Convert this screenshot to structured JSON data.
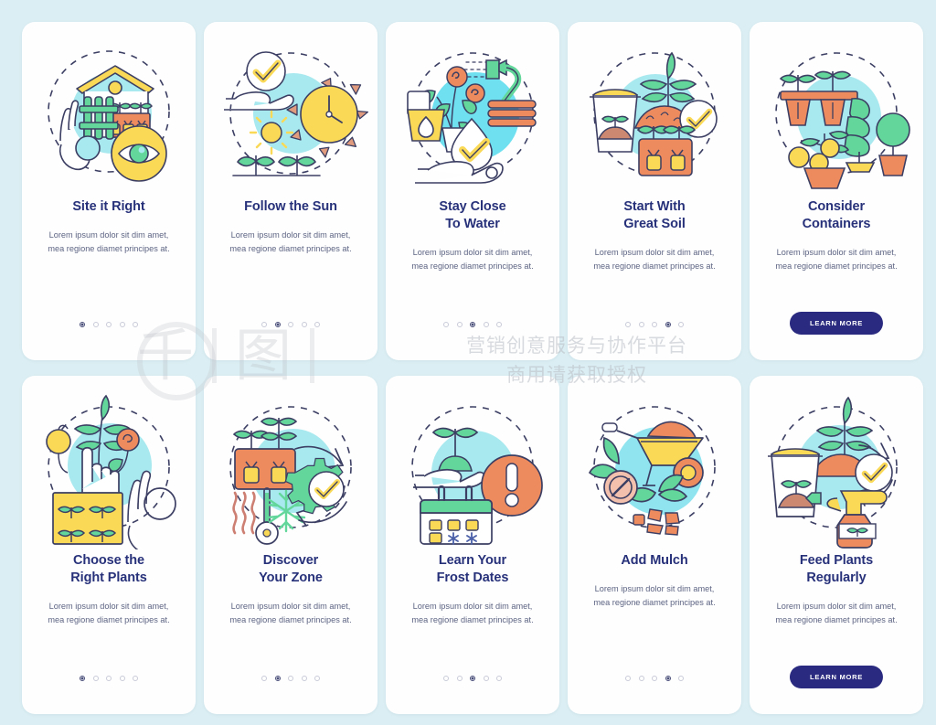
{
  "page": {
    "background_color": "#daeef3",
    "card_background": "#fefefe",
    "title_color": "#27317a",
    "body_color": "#5d6483",
    "accent_button_color": "#2a2a80",
    "dot_active_color": "#4a4f7a",
    "dot_inactive_color": "#c9cbd8"
  },
  "watermark": {
    "char_left": "千",
    "char_right": "图",
    "line1": "营销创意服务与协作平台",
    "line2": "商用请获取授权"
  },
  "cards": [
    {
      "id": "site-it-right",
      "icon": "garden-house-eye-icon",
      "title": "Site it Right",
      "body": "Lorem ipsum dolor sit dim amet, mea regione diamet principes at.",
      "dots": {
        "count": 5,
        "active_index": 0
      },
      "button": null
    },
    {
      "id": "follow-the-sun",
      "icon": "sun-clock-seedlings-icon",
      "title": "Follow the Sun",
      "body": "Lorem ipsum dolor sit dim amet, mea regione diamet principes at.",
      "dots": {
        "count": 5,
        "active_index": 1
      },
      "button": null
    },
    {
      "id": "stay-close-to-water",
      "icon": "watering-can-hose-droplet-icon",
      "title": "Stay Close\nTo Water",
      "title_line1": "Stay Close",
      "title_line2": "To Water",
      "body": "Lorem ipsum dolor sit dim amet, mea regione diamet principes at.",
      "dots": {
        "count": 5,
        "active_index": 2
      },
      "button": null
    },
    {
      "id": "start-with-great-soil",
      "icon": "soil-bag-seedling-check-icon",
      "title_line1": "Start With",
      "title_line2": "Great Soil",
      "body": "Lorem ipsum dolor sit dim amet, mea regione diamet principes at.",
      "dots": {
        "count": 5,
        "active_index": 3
      },
      "button": null
    },
    {
      "id": "consider-containers",
      "icon": "potted-plants-containers-icon",
      "title_line1": "Consider",
      "title_line2": "Containers",
      "body": "Lorem ipsum dolor sit dim amet, mea regione diamet principes at.",
      "dots": null,
      "button": {
        "label": "LEARN MORE"
      }
    },
    {
      "id": "choose-the-right-plants",
      "icon": "hand-pointing-seedling-tray-icon",
      "title_line1": "Choose the",
      "title_line2": "Right Plants",
      "body": "Lorem ipsum dolor sit dim amet, mea regione diamet principes at.",
      "dots": {
        "count": 5,
        "active_index": 0
      },
      "button": null
    },
    {
      "id": "discover-your-zone",
      "icon": "thermometer-gear-zone-icon",
      "title_line1": "Discover",
      "title_line2": "Your Zone",
      "body": "Lorem ipsum dolor sit dim amet, mea regione diamet principes at.",
      "dots": {
        "count": 5,
        "active_index": 1
      },
      "button": null
    },
    {
      "id": "learn-your-frost-dates",
      "icon": "calendar-frost-alert-icon",
      "title_line1": "Learn Your",
      "title_line2": "Frost Dates",
      "body": "Lorem ipsum dolor sit dim amet, mea regione diamet principes at.",
      "dots": {
        "count": 5,
        "active_index": 2
      },
      "button": null
    },
    {
      "id": "add-mulch",
      "icon": "wheelbarrow-mulch-icon",
      "title_line1": "Add Mulch",
      "title_line2": "",
      "body": "Lorem ipsum dolor sit dim amet, mea regione diamet principes at.",
      "dots": {
        "count": 5,
        "active_index": 3
      },
      "button": null
    },
    {
      "id": "feed-plants-regularly",
      "icon": "fertilizer-spray-bottle-icon",
      "title_line1": "Feed Plants",
      "title_line2": "Regularly",
      "body": "Lorem ipsum dolor sit dim amet, mea regione diamet principes at.",
      "dots": null,
      "button": {
        "label": "LEARN MORE"
      }
    }
  ]
}
